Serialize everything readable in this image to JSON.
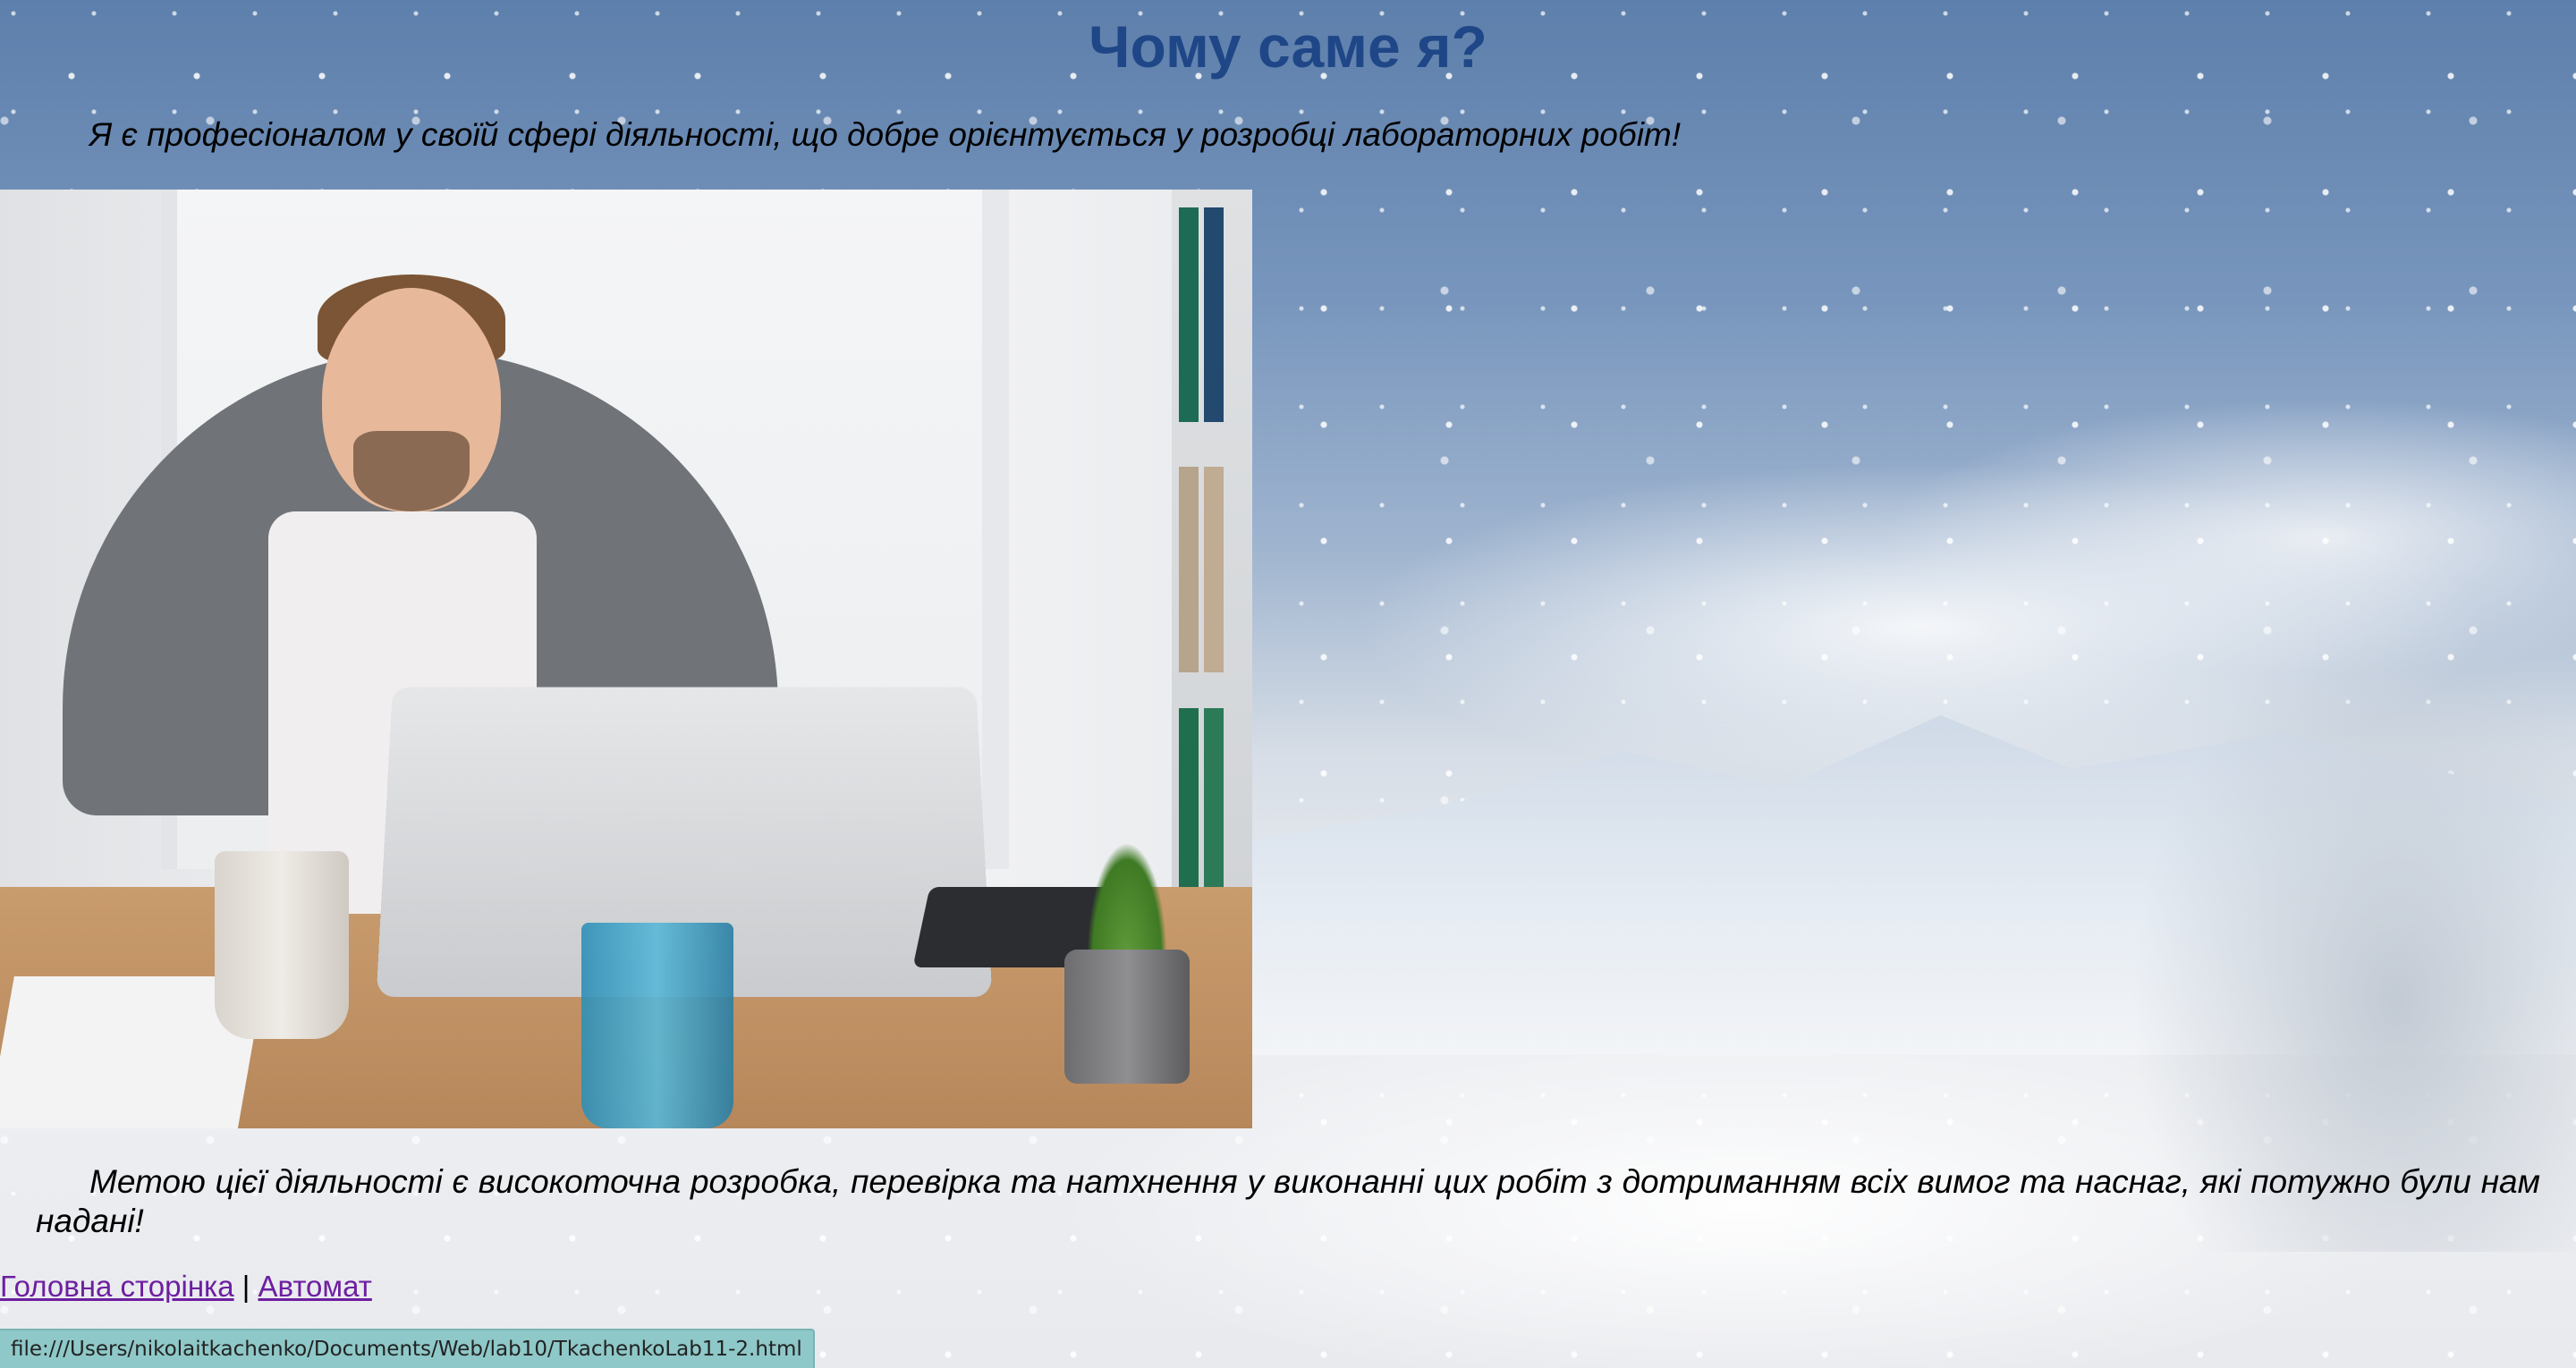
{
  "page": {
    "title": "Чому саме я?",
    "intro": "Я є професіоналом у своїй сфері діяльності, що добре орієнтується у розробці лабораторних робіт!",
    "goal": "Метою цієї діяльності є високоточна розробка, перевірка та натхнення у виконанні цих робіт з дотриманням всіх вимог та наснаг, які потужно були нам надані!"
  },
  "nav": {
    "home_link": "Головна сторінка",
    "separator": "|",
    "automat_link": "Автомат"
  },
  "statusbar": {
    "url": "file:///Users/nikolaitkachenko/Documents/Web/lab10/TkachenkoLab11-2.html"
  },
  "colors": {
    "title": "#1f4787",
    "link_visited": "#6d1fa0",
    "statusbar_bg": "#8fc8c8"
  }
}
